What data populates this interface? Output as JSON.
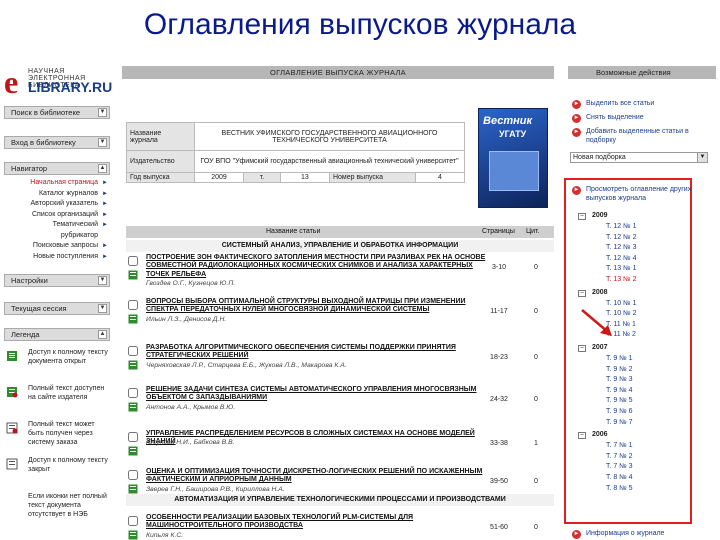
{
  "slide_title": "Оглавления выпусков  журнала",
  "logo": {
    "mark": "e",
    "top_line": "НАУЧНАЯ ЭЛЕКТРОННАЯ БИБЛИОТЕКА",
    "brand": "LIBRARY.RU"
  },
  "left": {
    "search_bar": "Поиск в библиотеке",
    "login_bar": "Вход в библиотеку",
    "nav_bar": "Навигатор",
    "nav_items": [
      "Начальная страница",
      "Каталог журналов",
      "Авторский указатель",
      "Список организаций",
      "Тематический рубрикатор",
      "Поисковые запросы",
      "Новые поступления"
    ],
    "settings_bar": "Настройки",
    "session_bar": "Текущая сессия",
    "legend_bar": "Легенда",
    "legend_items": [
      "Доступ к полному тексту документа открыт",
      "Полный текст доступен на сайте издателя",
      "Полный текст может быть получен через систему заказа",
      "Доступ к полному тексту закрыт",
      "Если иконки нет полный текст документа отсутствует в НЭБ"
    ]
  },
  "middle": {
    "header": "ОГЛАВЛЕНИЕ ВЫПУСКА ЖУРНАЛА",
    "info": {
      "journal_label": "Название журнала",
      "journal_value": "ВЕСТНИК УФИМСКОГО ГОСУДАРСТВЕННОГО АВИАЦИОННОГО ТЕХНИЧЕСКОГО УНИВЕРСИТЕТА",
      "publisher_label": "Издательство",
      "publisher_value": "ГОУ ВПО \"Уфимский государственный авиационный технический университет\"",
      "year_label": "Год выпуска",
      "year": "2009",
      "vol_label": "т.",
      "vol": "13",
      "issue_label": "Номер выпуска",
      "issue": "4"
    },
    "cover": {
      "title": "Вестник",
      "subtitle": "УГАТУ"
    },
    "table_header": {
      "title": "Название статьи",
      "pages": "Страницы",
      "cit": "Цит."
    },
    "sections": [
      "СИСТЕМНЫЙ АНАЛИЗ, УПРАВЛЕНИЕ И ОБРАБОТКА ИНФОРМАЦИИ",
      "АВТОМАТИЗАЦИЯ И УПРАВЛЕНИЕ ТЕХНОЛОГИЧЕСКИМИ ПРОЦЕССАМИ И ПРОИЗВОДСТВАМИ"
    ],
    "articles": [
      {
        "title": "ПОСТРОЕНИЕ ЗОН ФАКТИЧЕСКОГО ЗАТОПЛЕНИЯ МЕСТНОСТИ ПРИ РАЗЛИВАХ РЕК НА ОСНОВЕ СОВМЕСТНОЙ РАДИОЛОКАЦИОННЫХ КОСМИЧЕСКИХ СНИМКОВ И АНАЛИЗА ХАРАКТЕРНЫХ ТОЧЕК РЕЛЬЕФА",
        "authors": "Гвоздев О.Г., Кузнецов Ю.П.",
        "pages": "3-10",
        "cit": "0"
      },
      {
        "title": "ВОПРОСЫ ВЫБОРА ОПТИМАЛЬНОЙ СТРУКТУРЫ ВЫХОДНОЙ МАТРИЦЫ ПРИ ИЗМЕНЕНИИ СПЕКТРА ПЕРЕДАТОЧНЫХ НУЛЕЙ МНОГОСВЯЗНОЙ ДИНАМИЧЕСКОЙ СИСТЕМЫ",
        "authors": "Ильин Л.З., Денисов Д.Н.",
        "pages": "11-17",
        "cit": "0"
      },
      {
        "title": "РАЗРАБОТКА АЛГОРИТМИЧЕСКОГО ОБЕСПЕЧЕНИЯ СИСТЕМЫ ПОДДЕРЖКИ ПРИНЯТИЯ СТРАТЕГИЧЕСКИХ РЕШЕНИЙ",
        "authors": "Черняховская Л.Р., Старцева Е.Б., Жукова Л.В., Макарова К.А.",
        "pages": "18-23",
        "cit": "0"
      },
      {
        "title": "РЕШЕНИЕ ЗАДАЧИ СИНТЕЗА СИСТЕМЫ АВТОМАТИЧЕСКОГО УПРАВЛЕНИЯ МНОГОСВЯЗНЫМ ОБЪЕКТОМ С ЗАПАЗДЫВАНИЯМИ",
        "authors": "Антонов А.А., Крымов В.Ю.",
        "pages": "24-32",
        "cit": "0"
      },
      {
        "title": "УПРАВЛЕНИЕ РАСПРЕДЕЛЕНИЕМ РЕСУРСОВ В СЛОЖНЫХ СИСТЕМАХ НА ОСНОВЕ МОДЕЛЕЙ ЗНАНИЙ",
        "authors": "Юсупова Н.И., Бабкова В.В.",
        "pages": "33-38",
        "cit": "1"
      },
      {
        "title": "ОЦЕНКА И ОПТИМИЗАЦИЯ ТОЧНОСТИ ДИСКРЕТНО-ЛОГИЧЕСКИХ РЕШЕНИЙ ПО ИСКАЖЕННЫМ ФАКТИЧЕСКИМ И АПРИОРНЫМ ДАННЫМ",
        "authors": "Зверев Г.Н., Баширова Р.В., Кириллова Н.А.",
        "pages": "39-50",
        "cit": "0"
      },
      {
        "title": "ОСОБЕННОСТИ РЕАЛИЗАЦИИ БАЗОВЫХ ТЕХНОЛОГИЙ PLM-СИСТЕМЫ ДЛЯ МАШИНОСТРОИТЕЛЬНОГО ПРОИЗВОДСТВА",
        "authors": "Кипьля К.С.",
        "pages": "51-60",
        "cit": "0"
      }
    ]
  },
  "right": {
    "header": "Возможные действия",
    "actions": [
      "Выделить все статьи",
      "Снять выделение",
      "Добавить выделенные статьи в подборку"
    ],
    "select_value": "Новая подборка",
    "view_other": "Просмотреть оглавление других выпусков журнала",
    "years": [
      {
        "year": "2009",
        "issues": [
          "Т. 12 № 1",
          "Т. 12 № 2",
          "Т. 12 № 3",
          "Т. 12 № 4",
          "Т. 13 № 1",
          "Т. 13 № 2"
        ]
      },
      {
        "year": "2008",
        "issues": [
          "Т. 10 № 1",
          "Т. 10 № 2",
          "Т. 11 № 1",
          "Т. 11 № 2"
        ]
      },
      {
        "year": "2007",
        "issues": [
          "Т. 9 № 1",
          "Т. 9 № 2",
          "Т. 9 № 3",
          "Т. 9 № 4",
          "Т. 9 № 5",
          "Т. 9 № 6",
          "Т. 9 № 7"
        ]
      },
      {
        "year": "2006",
        "issues": [
          "Т. 7 № 1",
          "Т. 7 № 2",
          "Т. 7 № 3",
          "Т. 8 № 4",
          "Т. 8 № 5"
        ]
      }
    ],
    "bottom_action": "Информация о журнале"
  }
}
